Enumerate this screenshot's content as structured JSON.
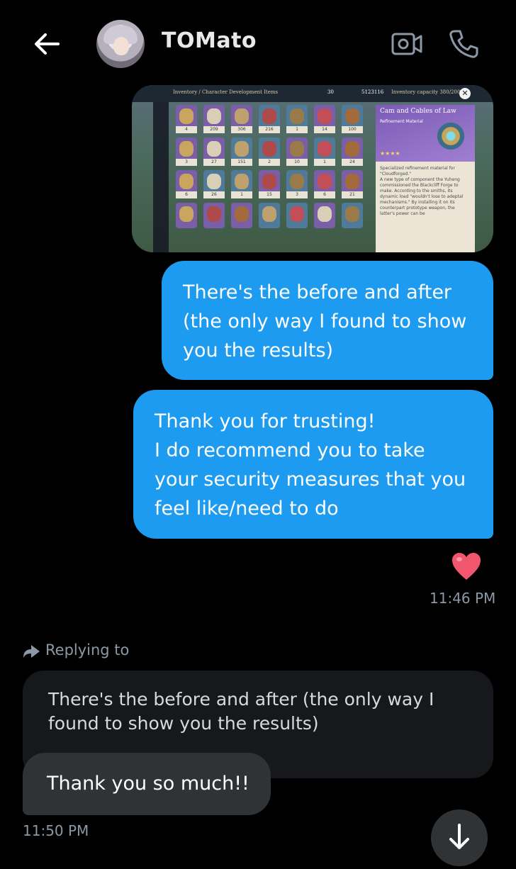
{
  "header": {
    "contact_name": "TOMato",
    "icons": [
      "arrow-left-icon",
      "video-camera-icon",
      "phone-icon"
    ]
  },
  "game_screenshot": {
    "breadcrumb": "Inventory / Character Development Items",
    "resin": "30",
    "mora": "5123116",
    "capacity": "Inventory capacity 380/2000",
    "item_counts": [
      "4",
      "209",
      "306",
      "216",
      "1",
      "14",
      "100",
      "3",
      "27",
      "151",
      "2",
      "10",
      "1",
      "24",
      "6",
      "26",
      "1",
      "15",
      "3",
      "6",
      "21"
    ],
    "panel": {
      "title": "Cam and Cables of Law",
      "subtitle": "Refinement Material",
      "stars": "★★★★",
      "description": "Specialized refinement material for \"Cloudforged.\"\nA new type of component the Yuheng commissioned the Blackcliff Forge to make. According to the smiths, its dynamic load \"wouldn't lose to adeptal mechanisms.\" By installing it on its counterpart prototype weapon, the latter's power can be"
    }
  },
  "messages": {
    "sent_1": "There's the before and after (the only way I found to show you the results)",
    "sent_2": "Thank you for trusting!\nI do recommend you to take your security measures that you feel like/need to do",
    "reaction": "heart",
    "time_1": "11:46 PM",
    "replying_label": "Replying to",
    "quoted_text": "There's the before and after (the only way I found to show you the results)",
    "received_1": "Thank you so much!!",
    "time_2": "11:50 PM"
  },
  "colors": {
    "sent_bubble": "#1d9bf0",
    "received_bubble": "#2f3336",
    "quote_bg": "#16181c",
    "meta_text": "#8b98a5"
  }
}
